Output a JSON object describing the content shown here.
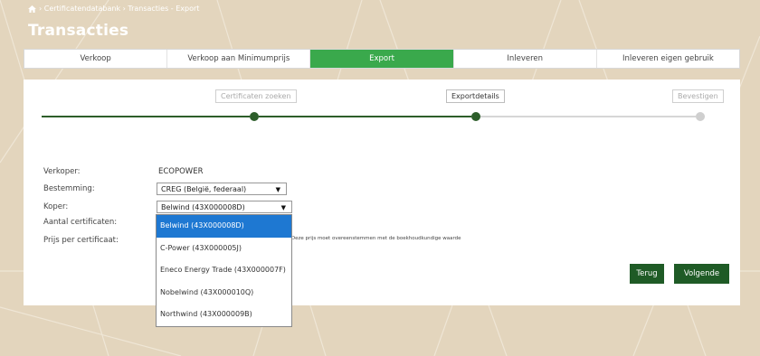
{
  "breadcrumb": {
    "text": "› Certificatendatabank › Transacties - Export"
  },
  "page": {
    "title": "Transacties"
  },
  "tabs": [
    {
      "label": "Verkoop"
    },
    {
      "label": "Verkoop aan Minimumprijs"
    },
    {
      "label": "Export",
      "active": true
    },
    {
      "label": "Inleveren"
    },
    {
      "label": "Inleveren eigen gebruik"
    }
  ],
  "steps": [
    {
      "label": "Certificaten zoeken",
      "state": "done"
    },
    {
      "label": "Exportdetails",
      "state": "current"
    },
    {
      "label": "Bevestigen",
      "state": "todo"
    }
  ],
  "form": {
    "seller": {
      "label": "Verkoper:",
      "value": "ECOPOWER"
    },
    "destination": {
      "label": "Bestemming:",
      "value": "CREG (België, federaal)"
    },
    "buyer": {
      "label": "Koper:",
      "value": "Belwind (43X000008D)"
    },
    "quantity": {
      "label": "Aantal certificaten:"
    },
    "price": {
      "label": "Prijs per certificaat:",
      "note": ") Deze prijs moet overeenstemmen met de boekhoudkundige waarde"
    }
  },
  "buttons": {
    "back": "Terug",
    "next": "Volgende"
  },
  "buyer_options": [
    {
      "label": "Belwind (43X000008D)",
      "selected": true
    },
    {
      "label": "C-Power (43X000005J)"
    },
    {
      "label": "Eneco Energy Trade (43X000007F)"
    },
    {
      "label": "Nobelwind (43X000010Q)"
    },
    {
      "label": "Northwind (43X000009B)"
    }
  ],
  "colors": {
    "background": "#e3d5bd",
    "accent_green": "#3aa94c",
    "dark_green": "#1f5b26",
    "selection_blue": "#1e78d2"
  }
}
